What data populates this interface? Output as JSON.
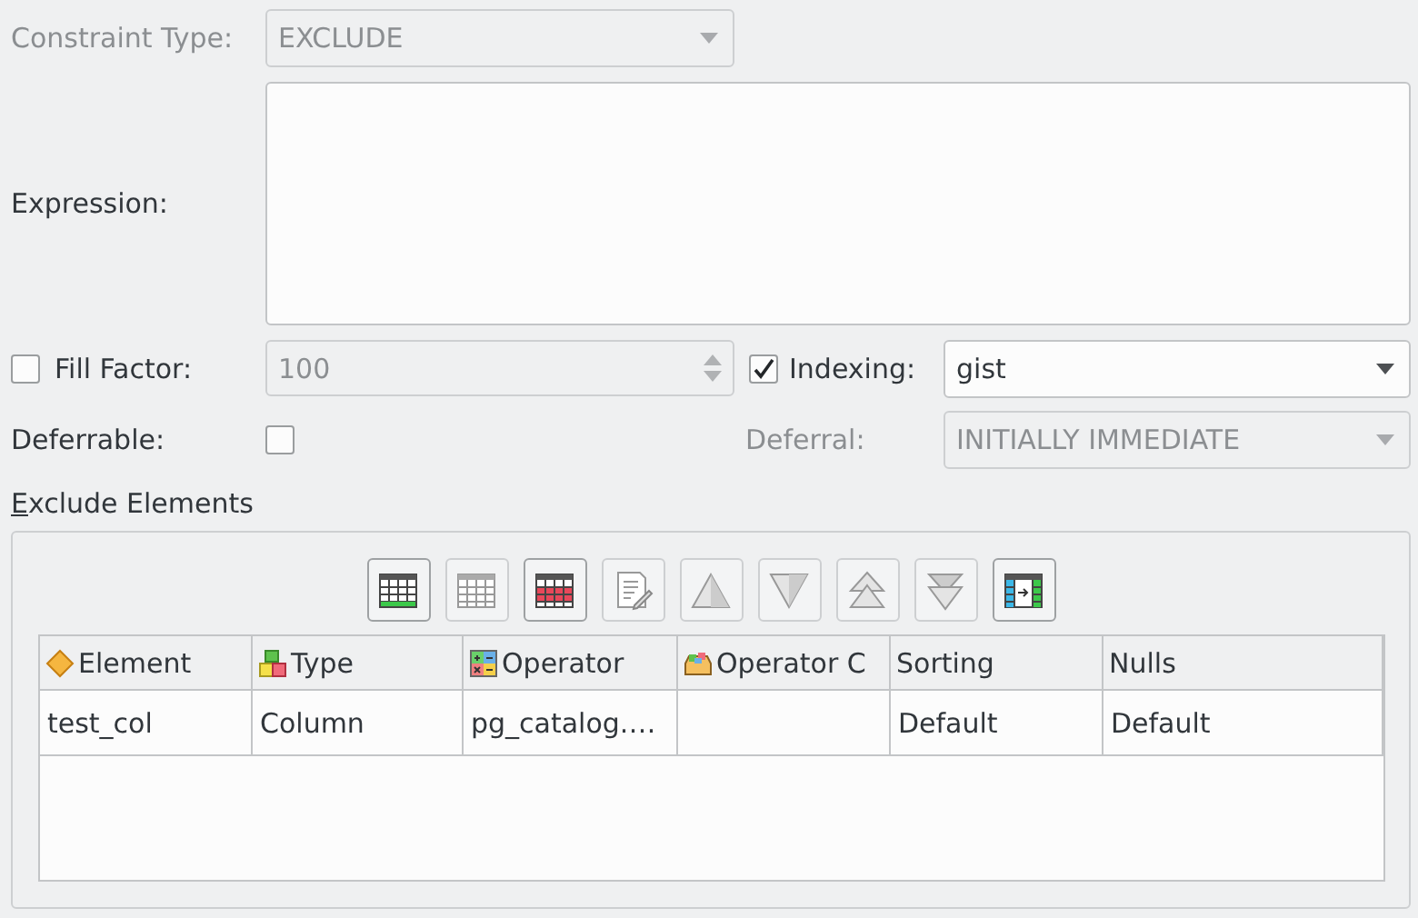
{
  "constraint_type": {
    "label": "Constraint Type:",
    "value": "EXCLUDE",
    "disabled": true
  },
  "expression": {
    "label": "Expression:"
  },
  "fill_factor": {
    "label": "Fill Factor:",
    "checked": false,
    "value": "100",
    "disabled": true
  },
  "indexing": {
    "label": "Indexing:",
    "checked": true,
    "value": "gist",
    "disabled": false
  },
  "deferrable": {
    "label": "Deferrable:",
    "checked": false
  },
  "deferral": {
    "label": "Deferral:",
    "value": "INITIALLY IMMEDIATE",
    "disabled": true
  },
  "exclude_elements": {
    "title": "Exclude Elements",
    "toolbar": [
      {
        "kind": "add",
        "disabled": false
      },
      {
        "kind": "grid",
        "disabled": true
      },
      {
        "kind": "remove",
        "disabled": false
      },
      {
        "kind": "edit",
        "disabled": true
      },
      {
        "kind": "up",
        "disabled": true
      },
      {
        "kind": "down",
        "disabled": true
      },
      {
        "kind": "top",
        "disabled": true
      },
      {
        "kind": "bottom",
        "disabled": true
      },
      {
        "kind": "insert",
        "disabled": false
      }
    ],
    "table": {
      "columns": [
        {
          "label": "Element",
          "kind": "element"
        },
        {
          "label": "Type",
          "kind": "type"
        },
        {
          "label": "Operator",
          "kind": "operator"
        },
        {
          "label": "Operator C",
          "kind": "opclass"
        },
        {
          "label": "Sorting",
          "kind": "none"
        },
        {
          "label": "Nulls",
          "kind": "none"
        }
      ],
      "rows": [
        {
          "cells": [
            "test_col",
            "Column",
            "pg_catalog.…",
            "",
            "Default",
            "Default"
          ]
        }
      ]
    }
  }
}
